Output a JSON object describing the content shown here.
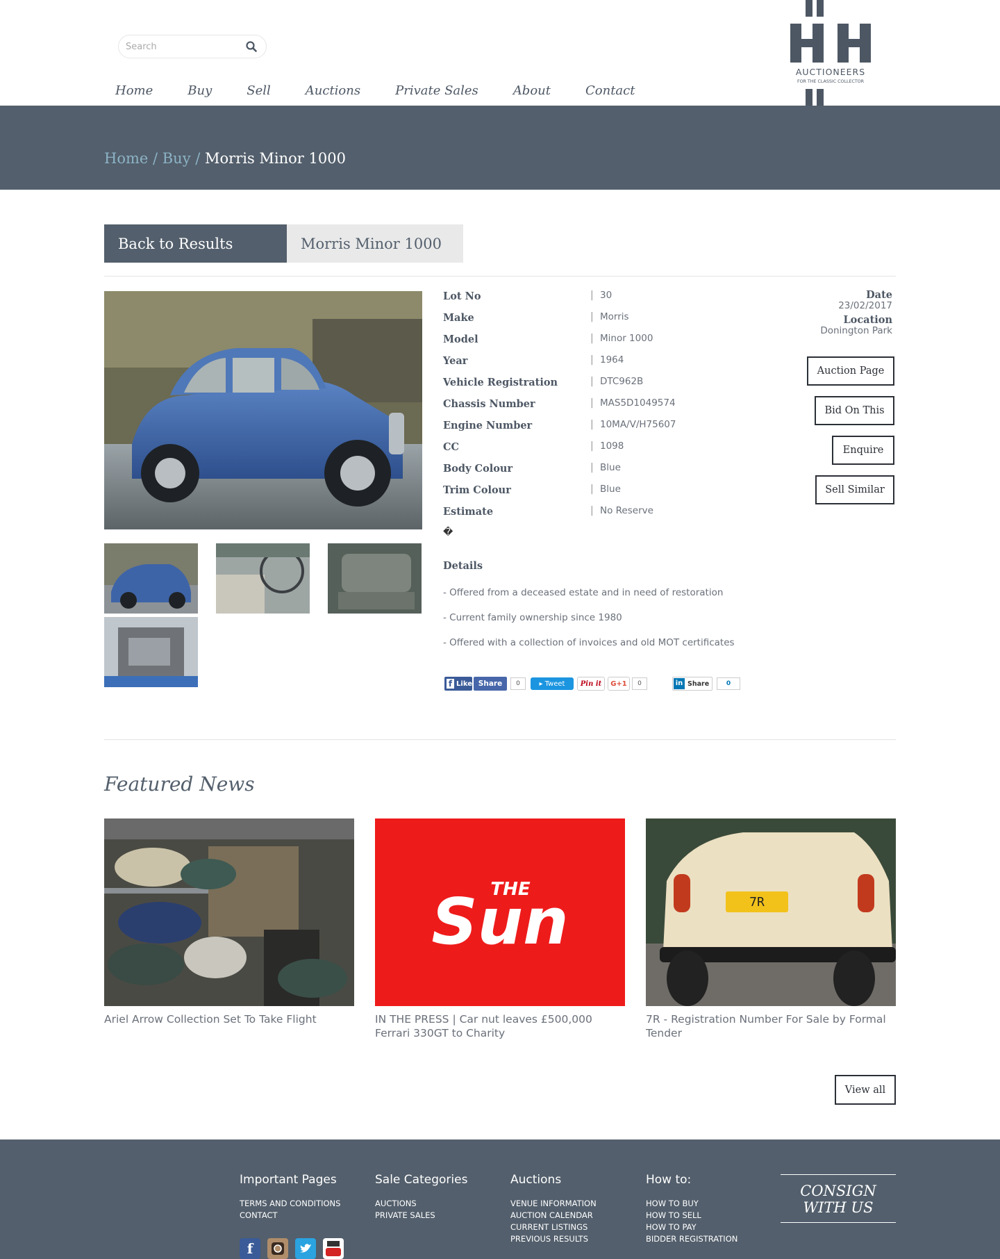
{
  "header": {
    "search_placeholder": "Search",
    "nav": [
      "Home",
      "Buy",
      "Sell",
      "Auctions",
      "Private Sales",
      "About",
      "Contact"
    ],
    "logo": {
      "word1": "AUCTIONEERS",
      "word2": "FOR THE CLASSIC COLLECTOR",
      "and": "AND",
      "color": "#4d5764"
    }
  },
  "breadcrumb": {
    "home": "Home",
    "sep": " / ",
    "buy": "Buy",
    "current": "Morris Minor 1000"
  },
  "tabs": {
    "back": "Back to Results",
    "title": "Morris Minor 1000"
  },
  "specs": [
    {
      "label": "Lot No",
      "value": "30"
    },
    {
      "label": "Make",
      "value": "Morris"
    },
    {
      "label": "Model",
      "value": "Minor 1000"
    },
    {
      "label": "Year",
      "value": "1964"
    },
    {
      "label": "Vehicle Registration",
      "value": "DTC962B"
    },
    {
      "label": "Chassis Number",
      "value": "MAS5D1049574"
    },
    {
      "label": "Engine Number",
      "value": "10MA/V/H75607"
    },
    {
      "label": "CC",
      "value": "1098"
    },
    {
      "label": "Body Colour",
      "value": "Blue"
    },
    {
      "label": "Trim Colour",
      "value": "Blue"
    },
    {
      "label": "Estimate",
      "value": "No Reserve"
    }
  ],
  "spec_separator": "|",
  "odd_char": "�",
  "details": {
    "heading": "Details",
    "lines": [
      "- Offered from a deceased estate and in need of restoration",
      "- Current family ownership since 1980",
      "- Offered with a collection of invoices and old MOT certificates"
    ]
  },
  "meta": {
    "date_label": "Date",
    "date": "23/02/2017",
    "location_label": "Location",
    "location": "Donington Park"
  },
  "actions": [
    "Auction Page",
    "Bid On This",
    "Enquire",
    "Sell Similar"
  ],
  "social": {
    "fb_like": "Like",
    "fb_share": "Share",
    "fb_count": "0",
    "tweet": "Tweet",
    "pinit": "Pin it",
    "gplus": "G+1",
    "gplus_count": "0",
    "li_share": "Share",
    "li_count": "0"
  },
  "featured": {
    "title": "Featured News",
    "cards": [
      {
        "caption": "Ariel Arrow Collection Set To Take Flight"
      },
      {
        "caption": "IN THE PRESS | Car nut leaves £500,000 Ferrari 330GT to Charity",
        "logo_top": "THE",
        "logo_main": "Sun"
      },
      {
        "caption": "7R - Registration Number For Sale by Formal Tender",
        "plate": "7R"
      }
    ],
    "view_all": "View all"
  },
  "footer": {
    "cols": [
      {
        "title": "Important Pages",
        "links": [
          "TERMS AND CONDITIONS",
          "CONTACT"
        ]
      },
      {
        "title": "Sale Categories",
        "links": [
          "AUCTIONS",
          "PRIVATE SALES"
        ]
      },
      {
        "title": "Auctions",
        "links": [
          "VENUE INFORMATION",
          "AUCTION CALENDAR",
          "CURRENT LISTINGS",
          "PREVIOUS RESULTS"
        ]
      },
      {
        "title": "How to:",
        "links": [
          "HOW TO BUY",
          "HOW TO SELL",
          "HOW TO PAY",
          "BIDDER REGISTRATION"
        ]
      }
    ],
    "consign": [
      "CONSIGN",
      "WITH US"
    ],
    "social_icons": [
      "facebook-icon",
      "instagram-icon",
      "twitter-icon",
      "youtube-icon"
    ]
  }
}
